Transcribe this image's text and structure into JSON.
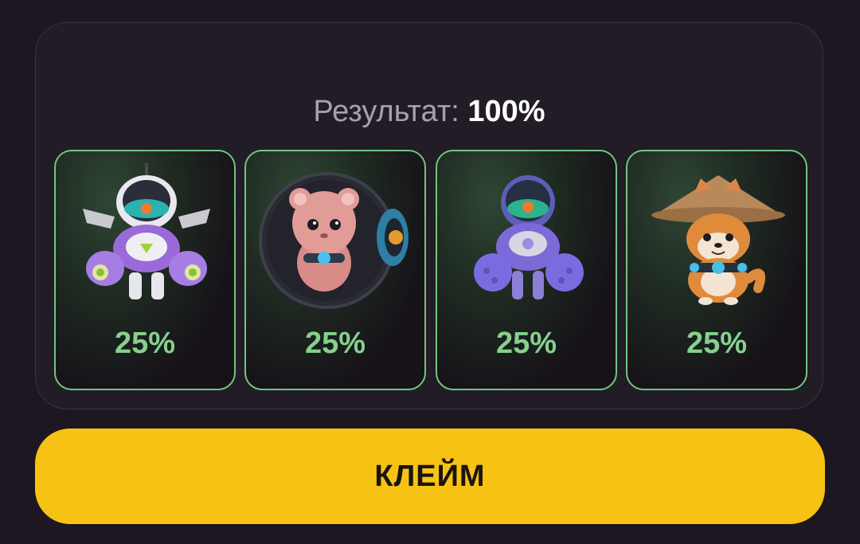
{
  "result": {
    "label": "Результат:",
    "value": "100%"
  },
  "cards": [
    {
      "name": "robot-astronaut",
      "percent": "25%"
    },
    {
      "name": "hamster-ball",
      "percent": "25%"
    },
    {
      "name": "robot-astronaut-purple",
      "percent": "25%"
    },
    {
      "name": "shiba-hat-dog",
      "percent": "25%"
    }
  ],
  "claim_button": {
    "label": "КЛЕЙМ"
  },
  "colors": {
    "background": "#1c1720",
    "card_border": "#72c67e",
    "percent_text": "#86d08e",
    "claim_button": "#f6c314"
  }
}
